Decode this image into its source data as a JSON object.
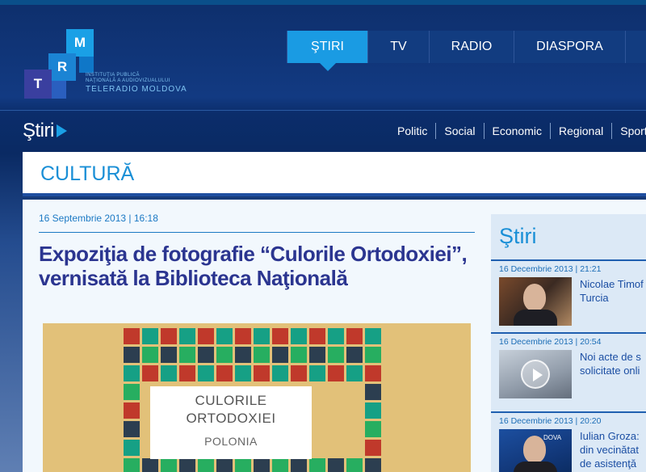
{
  "logo": {
    "letters": [
      "M",
      "R",
      "T"
    ],
    "line1": "Instituţia Publică",
    "line2": "Naţională a Audiovizualului",
    "line3": "TELERADIO MOLDOVA"
  },
  "main_nav": [
    {
      "label": "ŞTIRI",
      "active": true
    },
    {
      "label": "TV",
      "active": false
    },
    {
      "label": "RADIO",
      "active": false
    },
    {
      "label": "DIASPORA",
      "active": false
    }
  ],
  "section": {
    "title": "Ştiri"
  },
  "sub_nav": [
    "Politic",
    "Social",
    "Economic",
    "Regional",
    "Sport"
  ],
  "category": "CULTURĂ",
  "article": {
    "date": "16 Septembrie 2013 | 16:18",
    "headline": "Expoziţia de fotografie “Culorile Ortodoxiei”, vernisată la Biblioteca Naţională",
    "image_card": {
      "line1": "CULORILE",
      "line2": "ORTODOXIEI",
      "line3": "POLONIA"
    }
  },
  "sidebar": {
    "title": "Ştiri",
    "items": [
      {
        "date": "16 Decembrie 2013 | 21:21",
        "text": "Nicolae Timof\nTurcia"
      },
      {
        "date": "16 Decembrie 2013 | 20:54",
        "text": "Noi acte de s\nsolicitate onli"
      },
      {
        "date": "16 Decembrie 2013 | 20:20",
        "text": "Iulian Groza:\ndin vecinătat\nde asistenţă",
        "thumb_badge": "DOVA"
      }
    ]
  },
  "colors": {
    "accent": "#1a9be3",
    "header_bg": "#123c80",
    "headline": "#2b3590",
    "category": "#1a8fd6"
  }
}
